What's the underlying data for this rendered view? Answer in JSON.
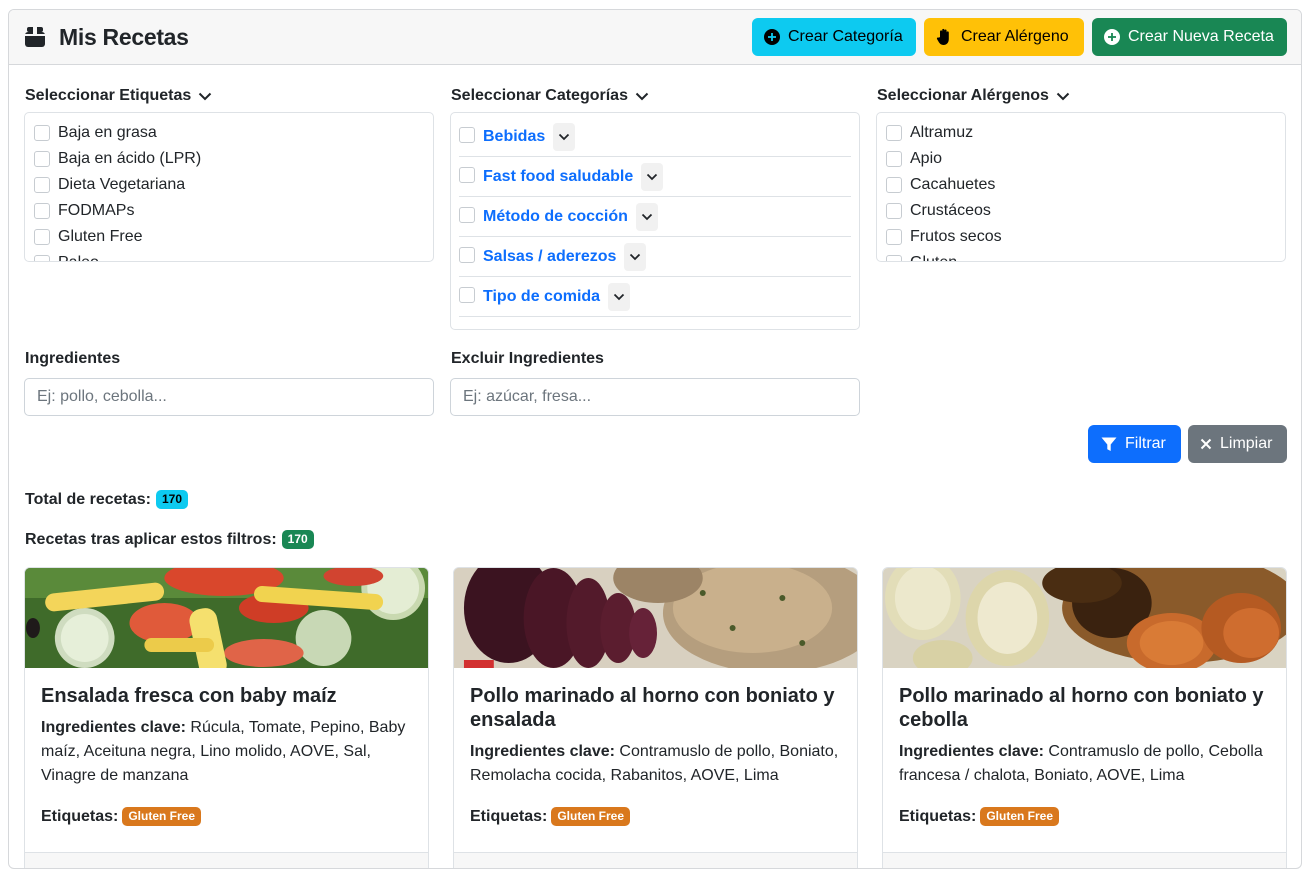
{
  "header": {
    "title": "Mis Recetas",
    "buttons": {
      "create_category": "Crear Categoría",
      "create_allergen": "Crear Alérgeno",
      "create_recipe": "Crear Nueva Receta"
    }
  },
  "filters": {
    "tags": {
      "label": "Seleccionar Etiquetas",
      "items": [
        "Baja en grasa",
        "Baja en ácido (LPR)",
        "Dieta Vegetariana",
        "FODMAPs",
        "Gluten Free",
        "Paleo"
      ]
    },
    "categories": {
      "label": "Seleccionar Categorías",
      "items": [
        "Bebidas",
        "Fast food saludable",
        "Método de cocción",
        "Salsas / aderezos",
        "Tipo de comida"
      ]
    },
    "allergens": {
      "label": "Seleccionar Alérgenos",
      "items": [
        "Altramuz",
        "Apio",
        "Cacahuetes",
        "Crustáceos",
        "Frutos secos",
        "Gluten"
      ]
    },
    "ingredients": {
      "label": "Ingredientes",
      "placeholder": "Ej: pollo, cebolla..."
    },
    "exclude": {
      "label": "Excluir Ingredientes",
      "placeholder": "Ej: azúcar, fresa..."
    },
    "filter_button": "Filtrar",
    "clear_button": "Limpiar"
  },
  "summary": {
    "total_label": "Total de recetas:",
    "total_value": "170",
    "filtered_label": "Recetas tras aplicar estos filtros:",
    "filtered_value": "170"
  },
  "recipes": [
    {
      "title": "Ensalada fresca con baby maíz",
      "ingredients_label": "Ingredientes clave:",
      "ingredients": "Rúcula, Tomate, Pepino, Baby maíz, Aceituna negra, Lino molido, AOVE, Sal, Vinagre de manzana",
      "tags_label": "Etiquetas:",
      "tag": "Gluten Free"
    },
    {
      "title": "Pollo marinado al horno con boniato y ensalada",
      "ingredients_label": "Ingredientes clave:",
      "ingredients": "Contramuslo de pollo, Boniato, Remolacha cocida, Rabanitos, AOVE, Lima",
      "tags_label": "Etiquetas:",
      "tag": "Gluten Free"
    },
    {
      "title": "Pollo marinado al horno con boniato y cebolla",
      "ingredients_label": "Ingredientes clave:",
      "ingredients": "Contramuslo de pollo, Cebolla francesa / chalota, Boniato, AOVE, Lima",
      "tags_label": "Etiquetas:",
      "tag": "Gluten Free"
    }
  ],
  "icons": {
    "title": "book-icon",
    "create_category": "plus-circle-icon",
    "create_allergen": "hand-icon",
    "create_recipe": "plus-circle-icon",
    "filter": "funnel-icon",
    "clear": "x-icon",
    "dropdown": "chevron-down-icon"
  },
  "colors": {
    "info": "#0dcaf0",
    "warning": "#ffc107",
    "success": "#198754",
    "primary": "#0d6efd",
    "secondary": "#6c757d",
    "tag": "#d9781d"
  }
}
